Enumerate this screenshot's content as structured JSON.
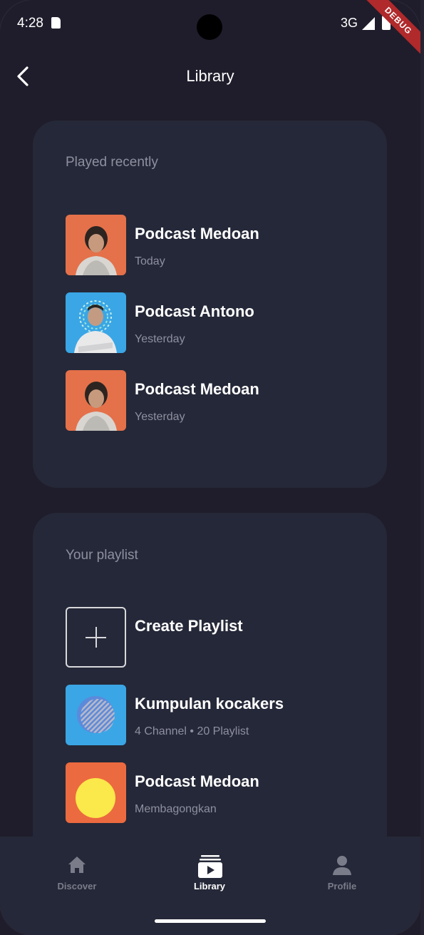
{
  "status_bar": {
    "time": "4:28",
    "network": "3G",
    "debug_banner": "DEBUG"
  },
  "app_bar": {
    "title": "Library"
  },
  "played_recently": {
    "title": "Played recently",
    "items": [
      {
        "name": "Podcast Medoan",
        "subtitle": "Today",
        "thumb_color": "#e4714a"
      },
      {
        "name": "Podcast Antono",
        "subtitle": "Yesterday",
        "thumb_color": "#3aa6e6"
      },
      {
        "name": "Podcast Medoan",
        "subtitle": "Yesterday",
        "thumb_color": "#e4714a"
      }
    ]
  },
  "your_playlist": {
    "title": "Your playlist",
    "create_label": "Create Playlist",
    "items": [
      {
        "name": "Kumpulan kocakers",
        "subtitle": "4 Channel • 20 Playlist",
        "thumb_color": "#3aa6e6"
      },
      {
        "name": "Podcast Medoan",
        "subtitle": "Membagongkan",
        "thumb_color": "#ec6a3f"
      }
    ]
  },
  "bottom_nav": {
    "items": [
      {
        "label": "Discover",
        "icon": "home-icon",
        "active": false
      },
      {
        "label": "Library",
        "icon": "library-icon",
        "active": true
      },
      {
        "label": "Profile",
        "icon": "person-icon",
        "active": false
      }
    ]
  }
}
